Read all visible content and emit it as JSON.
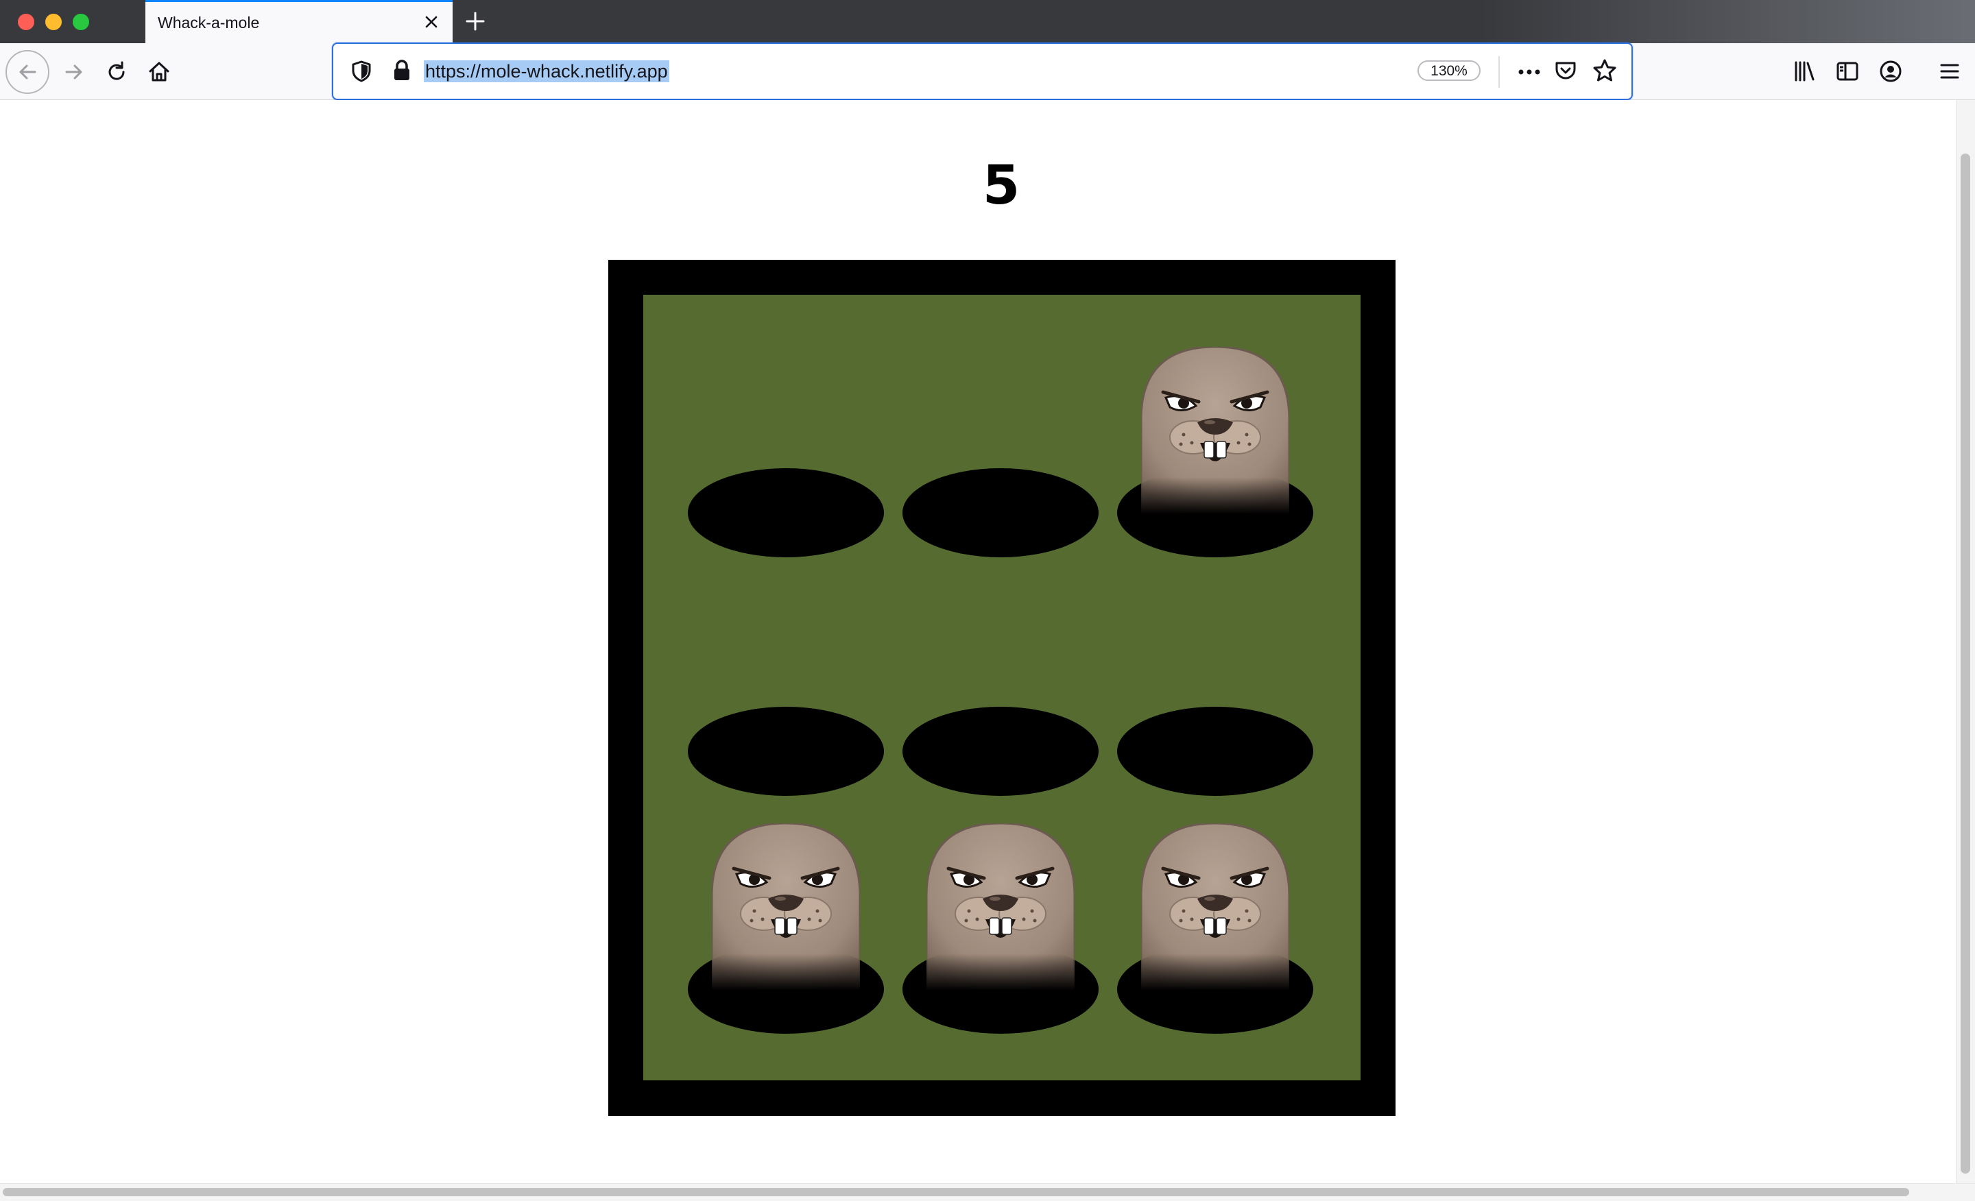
{
  "browser": {
    "tab_title": "Whack-a-mole",
    "url": "https://mole-whack.netlify.app",
    "zoom": "130%"
  },
  "game": {
    "score": "5",
    "grid": [
      [
        false,
        false,
        true
      ],
      [
        false,
        false,
        false
      ],
      [
        true,
        true,
        true
      ]
    ],
    "colors": {
      "board_frame": "#000000",
      "field": "#566b30",
      "hole": "#000000",
      "mole_fur": "#a38f80"
    }
  },
  "icons": [
    "back-arrow-icon",
    "forward-arrow-icon",
    "reload-icon",
    "home-icon",
    "shield-icon",
    "lock-icon",
    "more-icon",
    "pocket-icon",
    "star-icon",
    "library-icon",
    "sidebar-icon",
    "account-icon",
    "menu-icon",
    "close-icon",
    "plus-icon"
  ]
}
